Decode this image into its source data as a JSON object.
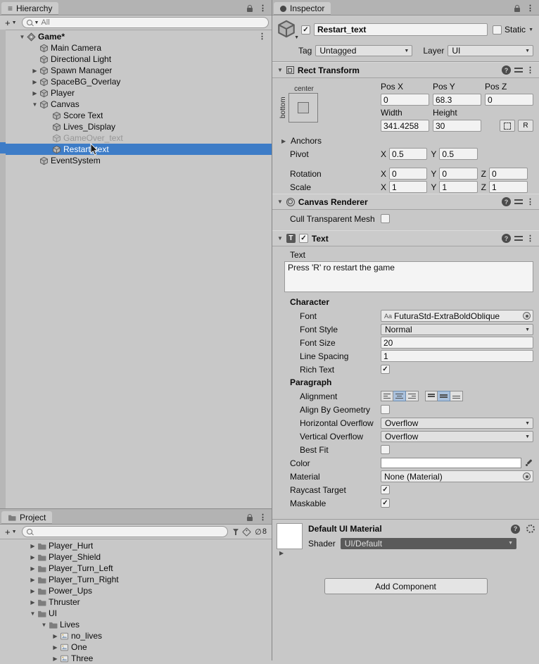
{
  "hierarchy": {
    "tab_label": "Hierarchy",
    "search_placeholder": "All",
    "items": [
      {
        "label": "Game*"
      },
      {
        "label": "Main Camera"
      },
      {
        "label": "Directional Light"
      },
      {
        "label": "Spawn Manager"
      },
      {
        "label": "SpaceBG_Overlay"
      },
      {
        "label": "Player"
      },
      {
        "label": "Canvas"
      },
      {
        "label": "Score Text"
      },
      {
        "label": "Lives_Display"
      },
      {
        "label": "GameOver_text"
      },
      {
        "label": "Restart_text"
      },
      {
        "label": "EventSystem"
      }
    ]
  },
  "project": {
    "tab_label": "Project",
    "hidden_count": "8",
    "items": [
      {
        "label": "Player_Hurt"
      },
      {
        "label": "Player_Shield"
      },
      {
        "label": "Player_Turn_Left"
      },
      {
        "label": "Player_Turn_Right"
      },
      {
        "label": "Power_Ups"
      },
      {
        "label": "Thruster"
      },
      {
        "label": "UI"
      },
      {
        "label": "Lives"
      },
      {
        "label": "no_lives"
      },
      {
        "label": "One"
      },
      {
        "label": "Three"
      }
    ]
  },
  "inspector": {
    "tab_label": "Inspector",
    "name_value": "Restart_text",
    "static_label": "Static",
    "tag_label": "Tag",
    "tag_value": "Untagged",
    "layer_label": "Layer",
    "layer_value": "UI",
    "rect_transform": {
      "title": "Rect Transform",
      "anchor_horizontal": "center",
      "anchor_vertical": "bottom",
      "pos_x_label": "Pos X",
      "pos_y_label": "Pos Y",
      "pos_z_label": "Pos Z",
      "pos_x": "0",
      "pos_y": "68.3",
      "pos_z": "0",
      "width_label": "Width",
      "height_label": "Height",
      "width": "341.4258",
      "height": "30",
      "r_button_label": "R",
      "anchors_label": "Anchors",
      "pivot_label": "Pivot",
      "pivot_x": "0.5",
      "pivot_y": "0.5",
      "rotation_label": "Rotation",
      "rotation_x": "0",
      "rotation_y": "0",
      "rotation_z": "0",
      "scale_label": "Scale",
      "scale_x": "1",
      "scale_y": "1",
      "scale_z": "1",
      "axis_x": "X",
      "axis_y": "Y",
      "axis_z": "Z"
    },
    "canvas_renderer": {
      "title": "Canvas Renderer",
      "cull_transparent_mesh_label": "Cull Transparent Mesh"
    },
    "text": {
      "title": "Text",
      "text_label": "Text",
      "text_value": "Press 'R' ro restart the game",
      "character_label": "Character",
      "font_label": "Font",
      "font_prefix": "Aa",
      "font_value": "FuturaStd-ExtraBoldOblique",
      "font_style_label": "Font Style",
      "font_style_value": "Normal",
      "font_size_label": "Font Size",
      "font_size_value": "20",
      "line_spacing_label": "Line Spacing",
      "line_spacing_value": "1",
      "rich_text_label": "Rich Text",
      "paragraph_label": "Paragraph",
      "alignment_label": "Alignment",
      "align_by_geometry_label": "Align By Geometry",
      "horizontal_overflow_label": "Horizontal Overflow",
      "horizontal_overflow_value": "Overflow",
      "vertical_overflow_label": "Vertical Overflow",
      "vertical_overflow_value": "Overflow",
      "best_fit_label": "Best Fit",
      "color_label": "Color",
      "material_label": "Material",
      "material_value": "None (Material)",
      "raycast_target_label": "Raycast Target",
      "maskable_label": "Maskable"
    },
    "material": {
      "title": "Default UI Material",
      "shader_label": "Shader",
      "shader_value": "UI/Default"
    },
    "add_component_label": "Add Component",
    "colors": {
      "selection_blue": "#3d7cc7",
      "text_color_value": "#ffffff"
    }
  }
}
